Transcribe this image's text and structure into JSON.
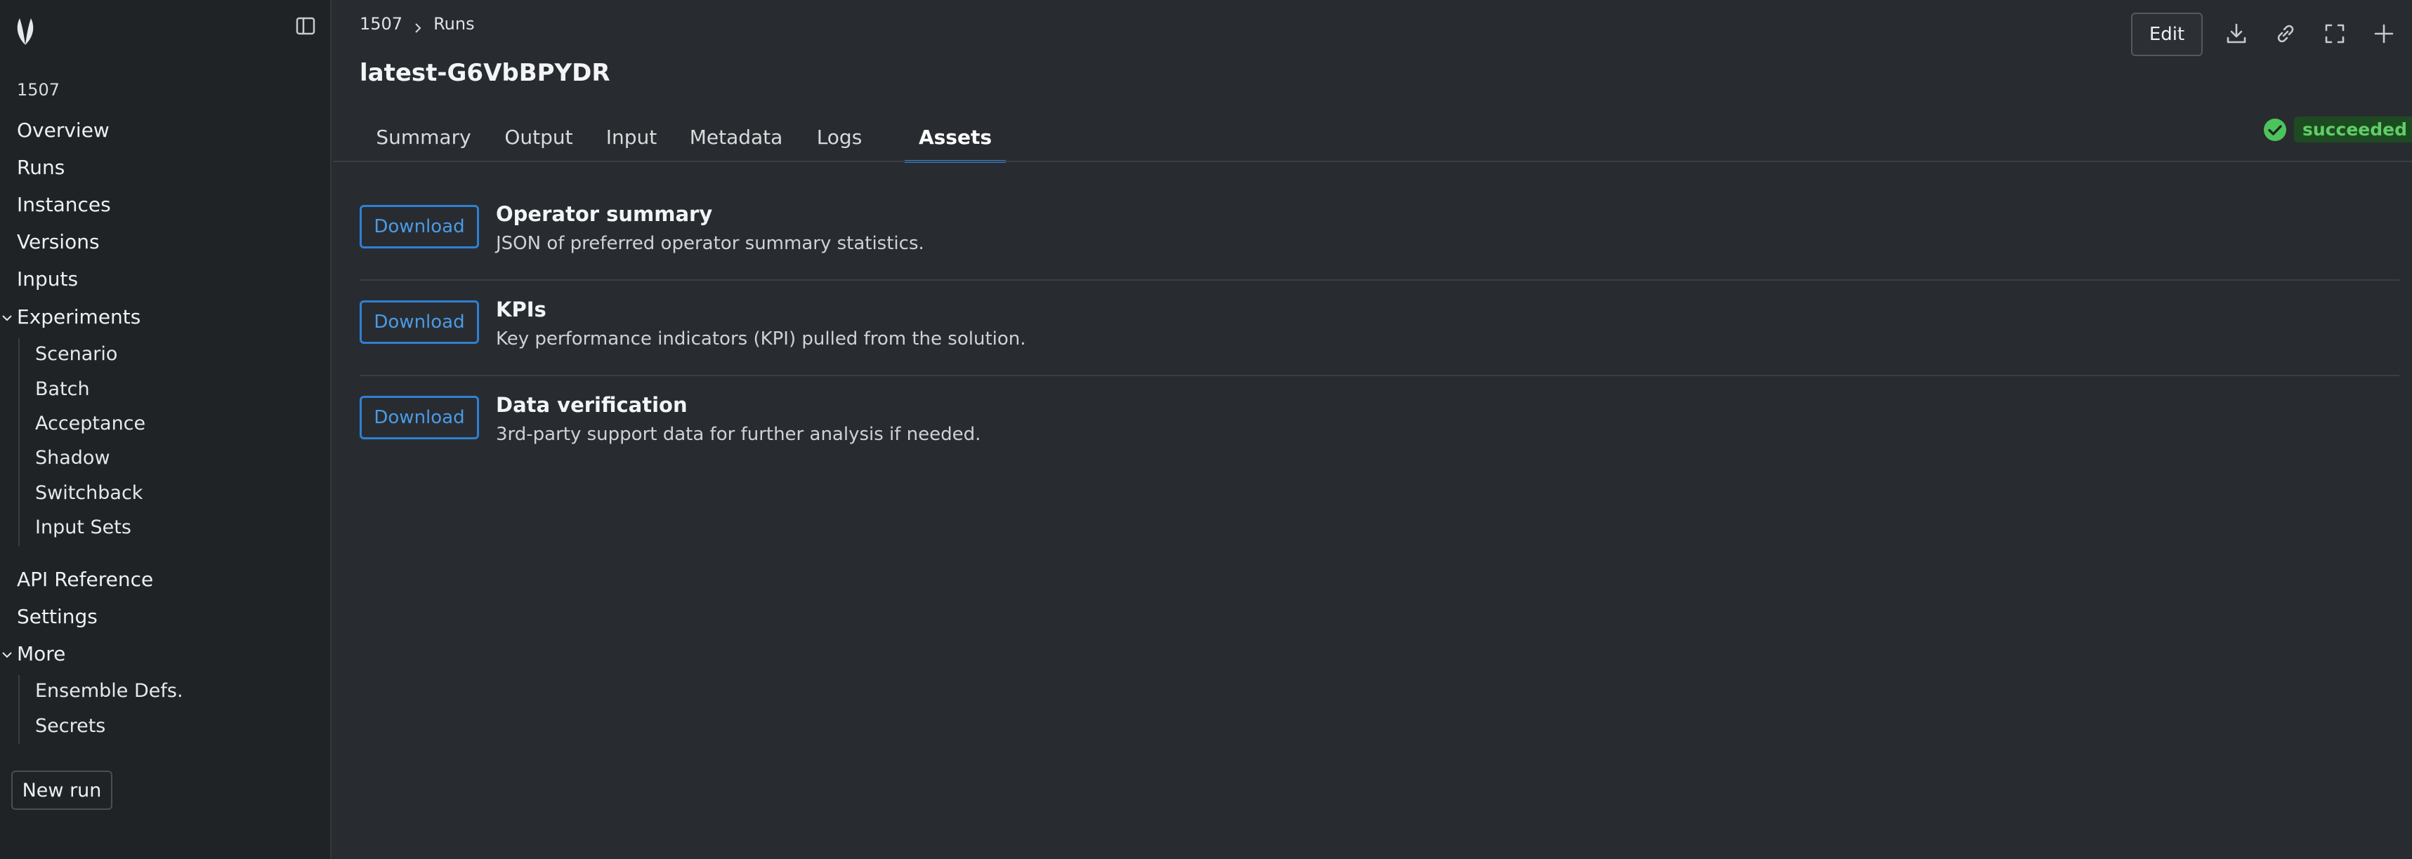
{
  "sidebar": {
    "org_id": "1507",
    "items": [
      {
        "label": "Overview"
      },
      {
        "label": "Runs"
      },
      {
        "label": "Instances"
      },
      {
        "label": "Versions"
      },
      {
        "label": "Inputs"
      },
      {
        "label": "Experiments"
      }
    ],
    "experiments_sub": [
      {
        "label": "Scenario"
      },
      {
        "label": "Batch"
      },
      {
        "label": "Acceptance"
      },
      {
        "label": "Shadow"
      },
      {
        "label": "Switchback"
      },
      {
        "label": "Input Sets"
      }
    ],
    "items2": [
      {
        "label": "API Reference"
      },
      {
        "label": "Settings"
      },
      {
        "label": "More"
      }
    ],
    "more_sub": [
      {
        "label": "Ensemble Defs."
      },
      {
        "label": "Secrets"
      }
    ],
    "new_run_label": "New run"
  },
  "header": {
    "breadcrumb": [
      "1507",
      "Runs"
    ],
    "title": "latest-G6VbBPYDR",
    "edit_label": "Edit",
    "icons": [
      "download-icon",
      "link-icon",
      "fullscreen-icon",
      "plus-icon"
    ]
  },
  "tabs": [
    {
      "label": "Summary"
    },
    {
      "label": "Output"
    },
    {
      "label": "Input"
    },
    {
      "label": "Metadata"
    },
    {
      "label": "Logs"
    },
    {
      "label": "Assets",
      "active": true
    }
  ],
  "status": {
    "label": "succeeded",
    "color": "#5fcf66"
  },
  "assets": [
    {
      "button": "Download",
      "title": "Operator summary",
      "description": "JSON of preferred operator summary statistics."
    },
    {
      "button": "Download",
      "title": "KPIs",
      "description": "Key performance indicators (KPI) pulled from the solution."
    },
    {
      "button": "Download",
      "title": "Data verification",
      "description": "3rd-party support data for further analysis if needed."
    }
  ],
  "colors": {
    "accent": "#2f80d4",
    "background": "#282c30",
    "sidebar": "#1f2326"
  }
}
